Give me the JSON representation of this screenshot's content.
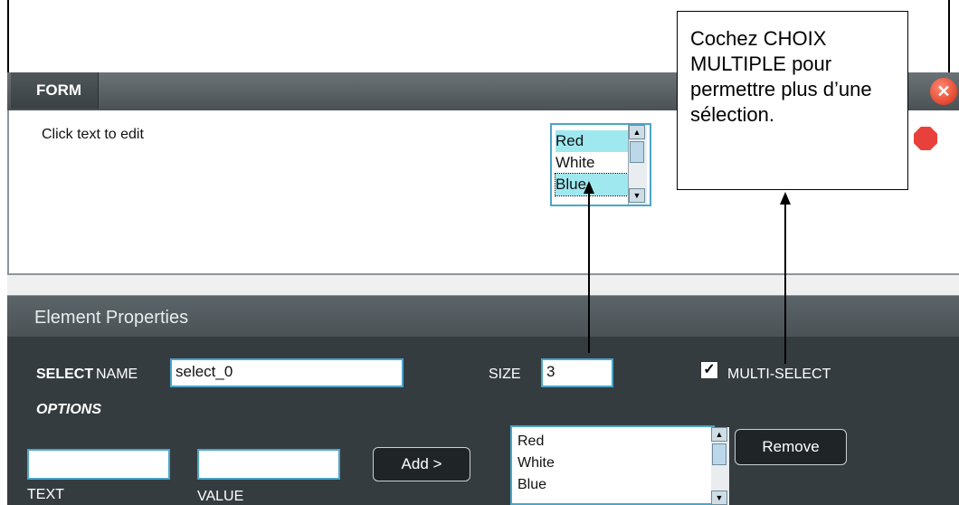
{
  "form": {
    "tab_label": "FORM",
    "placeholder_text": "Click text to edit",
    "preview_options": [
      "Red",
      "White",
      "Blue"
    ]
  },
  "properties": {
    "title": "Element Properties",
    "select_label": "SELECT",
    "name_label": "NAME",
    "name_value": "select_0",
    "size_label": "SIZE",
    "size_value": "3",
    "multi_select_label": "MULTI-SELECT",
    "multi_select_checked": true,
    "options_label": "OPTIONS",
    "text_label": "TEXT",
    "value_label": "VALUE",
    "text_value": "",
    "value_value": "",
    "add_button": "Add >",
    "remove_button": "Remove",
    "option_list": [
      "Red",
      "White",
      "Blue"
    ]
  },
  "callout": {
    "text": "Cochez CHOIX MULTIPLE pour permettre plus d’une sélection."
  },
  "colors": {
    "header_dark": "#4a5256",
    "panel_bg": "#353c40",
    "input_border": "#4aa6c8",
    "selected_option": "#9fe8f0",
    "close_red": "#d92b12"
  },
  "icons": [
    "close-icon",
    "stop-icon",
    "checkbox-checked-icon",
    "scroll-up-icon",
    "scroll-down-icon"
  ]
}
